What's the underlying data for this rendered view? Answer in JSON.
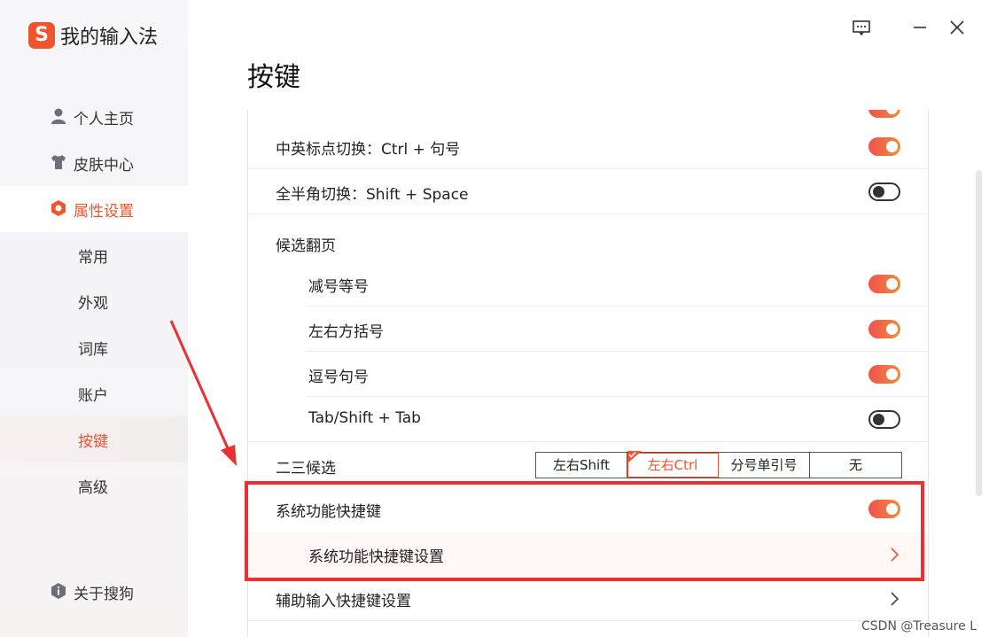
{
  "app": {
    "name": "我的输入法",
    "logo_letter": "S",
    "accent": "#f0542c"
  },
  "sidebar": {
    "items": [
      {
        "label": "个人主页",
        "icon": "user-icon"
      },
      {
        "label": "皮肤中心",
        "icon": "shirt-icon"
      },
      {
        "label": "属性设置",
        "icon": "hexagon-settings-icon",
        "active": true
      }
    ],
    "subitems": [
      {
        "label": "常用"
      },
      {
        "label": "外观"
      },
      {
        "label": "词库"
      },
      {
        "label": "账户"
      },
      {
        "label": "按键",
        "active": true
      },
      {
        "label": "高级"
      }
    ],
    "about": {
      "label": "关于搜狗",
      "icon": "info-icon"
    }
  },
  "page": {
    "title": "按键"
  },
  "settings": {
    "punct_switch": {
      "label": "中英标点切换：Ctrl + 句号",
      "on": true
    },
    "fullhalf_switch": {
      "label": "全半角切换：Shift + Space",
      "on": false
    },
    "paging_header": {
      "label": "候选翻页"
    },
    "paging": [
      {
        "label": "减号等号",
        "on": true
      },
      {
        "label": "左右方括号",
        "on": true
      },
      {
        "label": "逗号句号",
        "on": true
      },
      {
        "label": "Tab/Shift + Tab",
        "on": false
      }
    ],
    "second_third": {
      "label": "二三候选",
      "options": [
        "左右Shift",
        "左右Ctrl",
        "分号单引号",
        "无"
      ],
      "selected": "左右Ctrl"
    },
    "sys_shortcut": {
      "label": "系统功能快捷键",
      "on": true
    },
    "sys_shortcut_settings": {
      "label": "系统功能快捷键设置"
    },
    "aux_shortcut_settings": {
      "label": "辅助输入快捷键设置"
    }
  },
  "colors": {
    "toggle_on_start": "#f0524e",
    "toggle_on_end": "#f28b3a",
    "highlight": "#ec2f31"
  },
  "watermark": "CSDN @Treasure  L"
}
